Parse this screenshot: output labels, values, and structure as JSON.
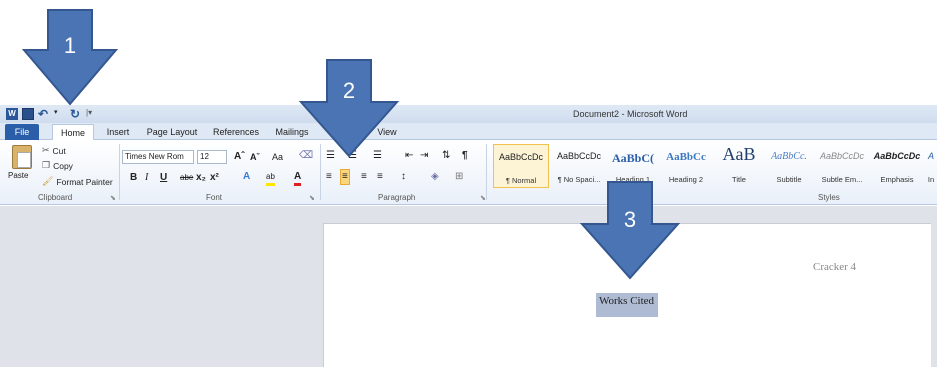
{
  "window": {
    "title": "Document2 - Microsoft Word"
  },
  "tabs": {
    "file": "File",
    "home": "Home",
    "insert": "Insert",
    "page_layout": "Page Layout",
    "references": "References",
    "mailings": "Mailings",
    "view": "View"
  },
  "clipboard": {
    "paste": "Paste",
    "cut": "Cut",
    "copy": "Copy",
    "format_painter": "Format Painter",
    "group_label": "Clipboard"
  },
  "font": {
    "family": "Times New Rom",
    "size": "12",
    "group_label": "Font",
    "grow": "Aˆ",
    "shrink": "Aˇ",
    "change_case": "Aa",
    "bold": "B",
    "italic": "I",
    "underline": "U",
    "strikethrough": "abe",
    "subscript": "x₂",
    "superscript": "x²"
  },
  "paragraph": {
    "group_label": "Paragraph"
  },
  "styles": {
    "group_label": "Styles",
    "items": [
      {
        "sample": "AaBbCcDc",
        "name": "¶ Normal"
      },
      {
        "sample": "AaBbCcDc",
        "name": "¶ No Spaci..."
      },
      {
        "sample": "AaBbC(",
        "name": "Heading 1"
      },
      {
        "sample": "AaBbCc",
        "name": "Heading 2"
      },
      {
        "sample": "AaB",
        "name": "Title"
      },
      {
        "sample": "AaBbCc.",
        "name": "Subtitle"
      },
      {
        "sample": "AaBbCcDc",
        "name": "Subtle Em..."
      },
      {
        "sample": "AaBbCcDc",
        "name": "Emphasis"
      },
      {
        "sample": "A",
        "name": "In"
      }
    ]
  },
  "document": {
    "header": "Cracker 4",
    "selected_text": "Works Cited"
  },
  "annotations": {
    "arrow_1": "1",
    "arrow_2": "2",
    "arrow_3": "3",
    "arrow_color": "#4a74b4",
    "arrow_outline": "#34578f"
  },
  "colors": {
    "file_tab": "#2a5ea8",
    "selection": "#aebbd3",
    "workspace": "#dfe3e9",
    "selected_style_border": "#f2c14e"
  }
}
